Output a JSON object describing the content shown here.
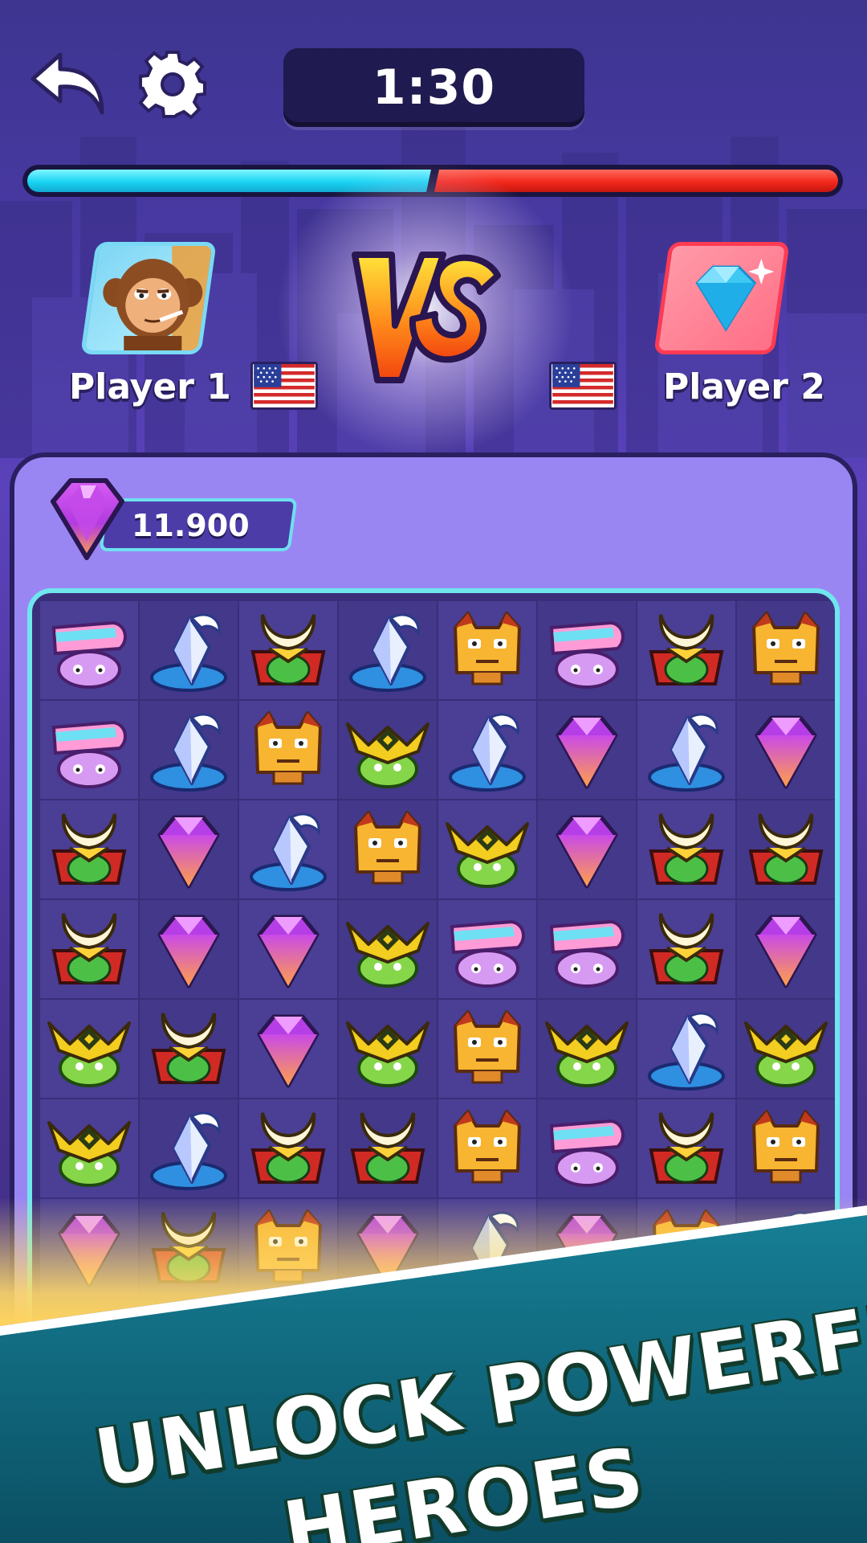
{
  "header": {
    "timer": "1:30",
    "back_icon": "back-arrow-icon",
    "settings_icon": "gear-icon"
  },
  "health": {
    "player1_fraction": 0.5,
    "player2_fraction": 0.5,
    "player1_color": "#19d4f3",
    "player2_color": "#f3281c"
  },
  "player1": {
    "name": "Player 1",
    "avatar": "monkey-avatar",
    "flag": "us-flag-icon"
  },
  "player2": {
    "name": "Player 2",
    "avatar": "diamond-avatar",
    "flag": "us-flag-icon"
  },
  "vs_label": "VS",
  "gems": {
    "count": "11.900",
    "icon": "purple-gem-icon"
  },
  "board": {
    "rows": [
      [
        "helmet",
        "crystal",
        "samurai",
        "crystal",
        "cat",
        "helmet",
        "samurai",
        "cat"
      ],
      [
        "helmet",
        "crystal",
        "cat",
        "viking",
        "crystal",
        "gem",
        "crystal",
        "gem"
      ],
      [
        "samurai",
        "gem",
        "crystal",
        "cat",
        "viking",
        "gem",
        "samurai",
        "samurai"
      ],
      [
        "samurai",
        "gem",
        "gem",
        "viking",
        "helmet",
        "helmet",
        "samurai",
        "gem"
      ],
      [
        "viking",
        "samurai",
        "gem",
        "viking",
        "cat",
        "viking",
        "crystal",
        "viking"
      ],
      [
        "viking",
        "crystal",
        "samurai",
        "samurai",
        "cat",
        "helmet",
        "samurai",
        "cat"
      ],
      [
        "gem",
        "samurai",
        "cat",
        "gem",
        "crystal",
        "gem",
        "cat",
        "crystal"
      ]
    ]
  },
  "promo": {
    "line1": "UNLOCK POWERFUL",
    "line2": "HEROES"
  }
}
